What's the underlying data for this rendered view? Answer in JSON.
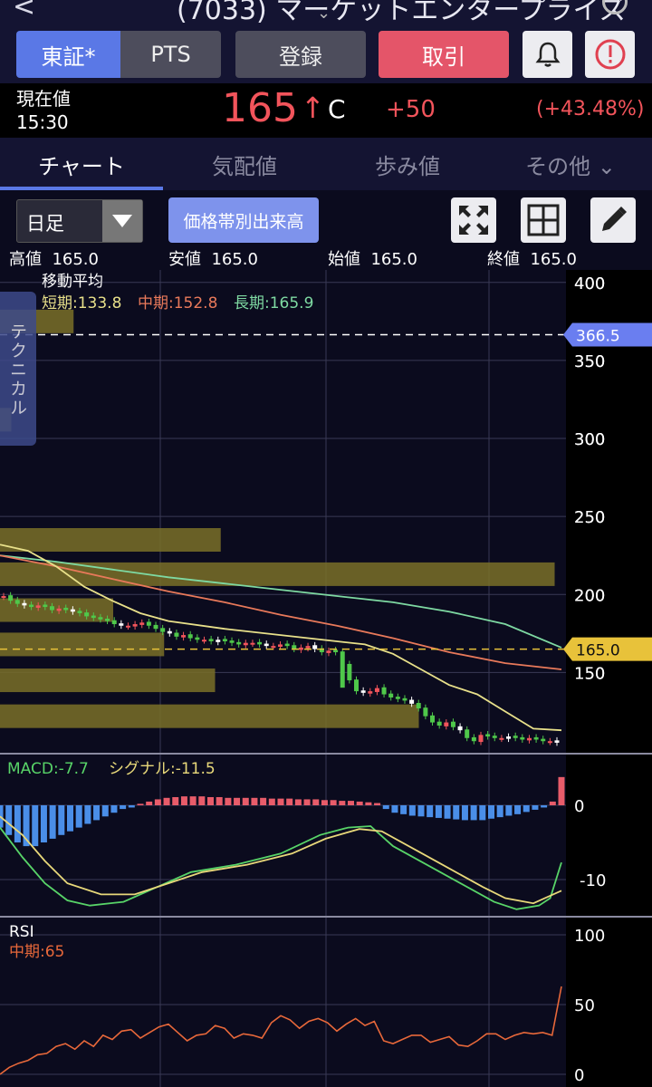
{
  "header": {
    "back_glyph": "<",
    "title": "(7033) マーケットエンタープライズ",
    "chevron": "⌄"
  },
  "actions": {
    "market_tse": "東証*",
    "market_pts": "PTS",
    "register": "登録",
    "trade": "取引"
  },
  "quote": {
    "label": "現在値",
    "time": "15:30",
    "price": "165",
    "arrow": "↑",
    "flag": "C",
    "change": "+50",
    "change_pct": "(+43.48%)"
  },
  "tabs": [
    "チャート",
    "気配値",
    "歩み値",
    "その他 ⌄"
  ],
  "toolbar": {
    "period": "日足",
    "volume_by_price": "価格帯別出来高",
    "icons": [
      "fullscreen-icon",
      "grid-icon",
      "pencil-icon"
    ]
  },
  "ohlc": [
    {
      "label": "高値",
      "value": "165.0"
    },
    {
      "label": "安値",
      "value": "165.0"
    },
    {
      "label": "始値",
      "value": "165.0"
    },
    {
      "label": "終値",
      "value": "165.0"
    }
  ],
  "technical_tab": "テクニカル",
  "colors": {
    "up": "#f2545b",
    "down": "#4fc84a",
    "short_ma": "#e8e08a",
    "mid_ma": "#e8795a",
    "long_ma": "#7ed9a2",
    "macd_pos": "#e85c6a",
    "macd_neg": "#4a8ee8",
    "macd_line": "#58d468",
    "signal_line": "#e8d87a",
    "rsi_line": "#e8683a",
    "volume_band": "#7a7028",
    "price_tag": "#e8c23a",
    "ref_tag": "#6a7ef0"
  },
  "chart_data": [
    {
      "type": "candlestick",
      "title": "移動平均",
      "ma_labels": {
        "short": "短期:133.8",
        "mid": "中期:152.8",
        "long": "長期:165.9"
      },
      "y_ticks": [
        400,
        350,
        300,
        250,
        200,
        150
      ],
      "ylim": [
        98,
        408
      ],
      "ref_line": {
        "value": 366.5,
        "label": "366.5"
      },
      "last_line": {
        "value": 165.0,
        "label": "165.0"
      },
      "volume_profile": [
        {
          "price": 375,
          "level": 0.13
        },
        {
          "price": 312,
          "level": 0.02
        },
        {
          "price": 235,
          "level": 0.39
        },
        {
          "price": 213,
          "level": 0.98
        },
        {
          "price": 190,
          "level": 0.2
        },
        {
          "price": 168,
          "level": 0.29
        },
        {
          "price": 145,
          "level": 0.38
        },
        {
          "price": 122,
          "level": 0.74
        }
      ],
      "candles_close": [
        199,
        196,
        194,
        193,
        192,
        193,
        192,
        190,
        191,
        190,
        189,
        188,
        186,
        185,
        184,
        183,
        181,
        180,
        180,
        181,
        182,
        180,
        178,
        176,
        175,
        173,
        174,
        172,
        171,
        171,
        170,
        171,
        170,
        169,
        168,
        169,
        169,
        168,
        167,
        167,
        168,
        167,
        165,
        166,
        167,
        165,
        163,
        164,
        163,
        155,
        145,
        138,
        137,
        138,
        140,
        136,
        134,
        133,
        132,
        130,
        127,
        122,
        118,
        116,
        118,
        115,
        113,
        108,
        106,
        110,
        109,
        108,
        108,
        109,
        108,
        107,
        108,
        107,
        106,
        106,
        105
      ],
      "ma_short": [
        [
          0,
          232
        ],
        [
          0.05,
          228
        ],
        [
          0.1,
          218
        ],
        [
          0.15,
          205
        ],
        [
          0.2,
          196
        ],
        [
          0.25,
          188
        ],
        [
          0.3,
          183
        ],
        [
          0.4,
          178
        ],
        [
          0.5,
          174
        ],
        [
          0.6,
          170
        ],
        [
          0.65,
          168
        ],
        [
          0.7,
          162
        ],
        [
          0.75,
          152
        ],
        [
          0.8,
          142
        ],
        [
          0.85,
          136
        ],
        [
          0.9,
          125
        ],
        [
          0.95,
          114
        ],
        [
          1.0,
          113
        ]
      ],
      "ma_mid": [
        [
          0,
          225
        ],
        [
          0.1,
          218
        ],
        [
          0.2,
          210
        ],
        [
          0.3,
          202
        ],
        [
          0.4,
          195
        ],
        [
          0.5,
          187
        ],
        [
          0.6,
          180
        ],
        [
          0.7,
          172
        ],
        [
          0.8,
          163
        ],
        [
          0.9,
          156
        ],
        [
          1.0,
          152
        ]
      ],
      "ma_long": [
        [
          0,
          225
        ],
        [
          0.1,
          221
        ],
        [
          0.2,
          216
        ],
        [
          0.3,
          211
        ],
        [
          0.4,
          207
        ],
        [
          0.5,
          203
        ],
        [
          0.6,
          199
        ],
        [
          0.7,
          195
        ],
        [
          0.8,
          189
        ],
        [
          0.9,
          181
        ],
        [
          1.0,
          166
        ]
      ]
    },
    {
      "type": "bar",
      "name": "MACD",
      "label_macd": "MACD:-7.7",
      "label_signal": "シグナル:-11.5",
      "y_ticks": [
        0,
        -10
      ],
      "ylim": [
        -15,
        5
      ],
      "histogram": [
        -3,
        -4,
        -5,
        -5.5,
        -5.5,
        -5,
        -4.5,
        -4,
        -3.5,
        -3,
        -2.5,
        -2,
        -1.5,
        -1,
        -0.5,
        -0.3,
        0.2,
        0.5,
        0.8,
        1,
        1.1,
        1.2,
        1.2,
        1.2,
        1.1,
        1.1,
        1,
        1,
        1,
        1,
        1,
        0.9,
        0.9,
        0.9,
        0.8,
        0.8,
        0.8,
        0.7,
        0.7,
        0.6,
        0.6,
        0.5,
        0.4,
        0.3,
        -0.5,
        -1,
        -1.2,
        -1.4,
        -1.5,
        -1.6,
        -1.7,
        -1.8,
        -1.9,
        -2,
        -2,
        -2,
        -1.8,
        -1.6,
        -1.4,
        -1.2,
        -0.9,
        -0.6,
        -0.3,
        0.5,
        3.8
      ],
      "macd_line": [
        [
          0,
          -3
        ],
        [
          0.04,
          -7
        ],
        [
          0.08,
          -10.5
        ],
        [
          0.12,
          -12.8
        ],
        [
          0.16,
          -13.5
        ],
        [
          0.22,
          -13
        ],
        [
          0.28,
          -11
        ],
        [
          0.34,
          -9
        ],
        [
          0.42,
          -8
        ],
        [
          0.5,
          -6.5
        ],
        [
          0.57,
          -4
        ],
        [
          0.62,
          -3
        ],
        [
          0.66,
          -2.8
        ],
        [
          0.7,
          -5.5
        ],
        [
          0.76,
          -8
        ],
        [
          0.82,
          -10.5
        ],
        [
          0.88,
          -13
        ],
        [
          0.92,
          -14
        ],
        [
          0.96,
          -13.5
        ],
        [
          0.98,
          -12.5
        ],
        [
          1.0,
          -7.7
        ]
      ],
      "signal_line": [
        [
          0,
          -1.5
        ],
        [
          0.04,
          -4
        ],
        [
          0.08,
          -7.5
        ],
        [
          0.12,
          -10.5
        ],
        [
          0.18,
          -12
        ],
        [
          0.24,
          -12
        ],
        [
          0.3,
          -10.5
        ],
        [
          0.36,
          -9
        ],
        [
          0.44,
          -8
        ],
        [
          0.52,
          -6.5
        ],
        [
          0.58,
          -4.5
        ],
        [
          0.64,
          -3.2
        ],
        [
          0.68,
          -3.5
        ],
        [
          0.74,
          -6
        ],
        [
          0.8,
          -8.5
        ],
        [
          0.86,
          -11
        ],
        [
          0.9,
          -12.5
        ],
        [
          0.95,
          -13.2
        ],
        [
          1.0,
          -11.5
        ]
      ]
    },
    {
      "type": "line",
      "name": "RSI",
      "label_mid": "中期:65",
      "y_ticks": [
        100,
        50,
        0
      ],
      "ylim": [
        0,
        100
      ],
      "values": [
        0,
        5,
        8,
        10,
        14,
        15,
        20,
        22,
        18,
        24,
        20,
        28,
        25,
        31,
        32,
        26,
        30,
        34,
        36,
        30,
        24,
        28,
        29,
        35,
        33,
        26,
        29,
        28,
        26,
        37,
        42,
        39,
        33,
        38,
        40,
        37,
        31,
        36,
        40,
        35,
        38,
        24,
        22,
        25,
        28,
        28,
        23,
        25,
        27,
        21,
        20,
        24,
        29,
        29,
        25,
        28,
        30,
        29,
        30,
        28,
        63
      ]
    }
  ]
}
